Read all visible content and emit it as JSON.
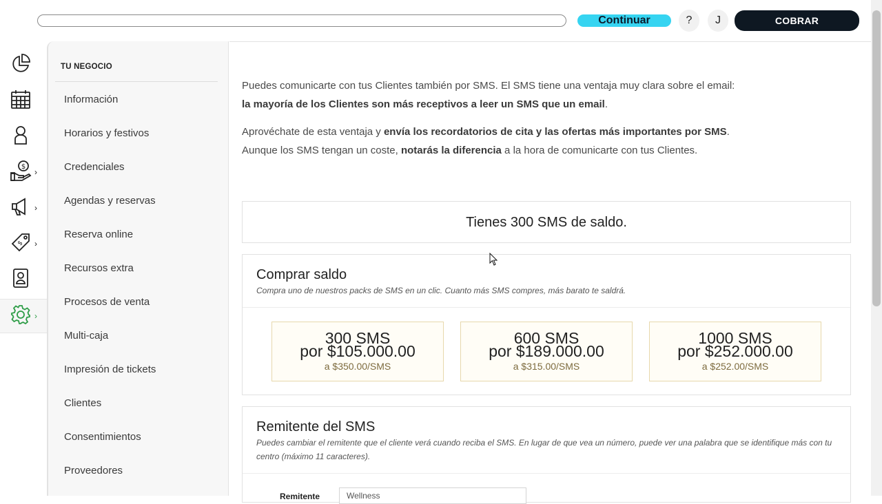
{
  "topbar": {
    "search_placeholder": "",
    "continue_label": "Continuar",
    "help_label": "?",
    "user_initial": "J",
    "charge_label": "COBRAR"
  },
  "rail": {
    "items": [
      {
        "icon": "pie-chart-icon",
        "has_chevron": false
      },
      {
        "icon": "calendar-icon",
        "has_chevron": false
      },
      {
        "icon": "person-icon",
        "has_chevron": false
      },
      {
        "icon": "money-hand-icon",
        "has_chevron": true
      },
      {
        "icon": "megaphone-icon",
        "has_chevron": true
      },
      {
        "icon": "tags-icon",
        "has_chevron": true
      },
      {
        "icon": "contact-card-icon",
        "has_chevron": false
      },
      {
        "icon": "gear-icon",
        "has_chevron": true,
        "active": true
      }
    ],
    "chevron": "›"
  },
  "sidenav": {
    "title": "TU NEGOCIO",
    "items": [
      {
        "label": "Información"
      },
      {
        "label": "Horarios y festivos"
      },
      {
        "label": "Credenciales"
      },
      {
        "label": "Agendas y reservas"
      },
      {
        "label": "Reserva online"
      },
      {
        "label": "Recursos extra"
      },
      {
        "label": "Procesos de venta"
      },
      {
        "label": "Multi-caja"
      },
      {
        "label": "Impresión de tickets"
      },
      {
        "label": "Clientes"
      },
      {
        "label": "Consentimientos"
      },
      {
        "label": "Proveedores"
      }
    ]
  },
  "intro": {
    "p1_a": "Puedes comunicarte con tus Clientes también por SMS. El SMS tiene una ventaja muy clara sobre el email: ",
    "p1_b": "la mayoría de los Clientes son más receptivos a leer un SMS que un email",
    "p1_c": ".",
    "p2_a": "Aprovéchate de esta ventaja y ",
    "p2_b": "envía los recordatorios de cita y las ofertas más importantes por SMS",
    "p2_c": ". Aunque los SMS tengan un coste, ",
    "p2_d": "notarás la diferencia",
    "p2_e": " a la hora de comunicarte con tus Clientes."
  },
  "balance": {
    "text": "Tienes 300 SMS de saldo."
  },
  "buy": {
    "title": "Comprar saldo",
    "subtitle": "Compra uno de nuestros packs de SMS en un clic. Cuanto más SMS compres, más barato te saldrá.",
    "packs": [
      {
        "qty": "300 SMS",
        "price": "por $105.000.00",
        "unit": "a $350.00/SMS"
      },
      {
        "qty": "600 SMS",
        "price": "por $189.000.00",
        "unit": "a $315.00/SMS"
      },
      {
        "qty": "1000 SMS",
        "price": "por $252.000.00",
        "unit": "a $252.00/SMS"
      }
    ]
  },
  "sender": {
    "title": "Remitente del SMS",
    "subtitle": "Puedes cambiar el remitente que el cliente verá cuando reciba el SMS. En lugar de que vea un número, puede ver una palabra que se identifique más con tu centro (máximo 11 caracteres).",
    "field_label": "Remitente",
    "field_value": "Wellness"
  },
  "colors": {
    "accent_cyan": "#36d4f1",
    "dark_button": "#0e1822",
    "active_icon": "#2e9d47",
    "pack_bg": "#fffdf6",
    "pack_border": "#e7d8ac"
  }
}
